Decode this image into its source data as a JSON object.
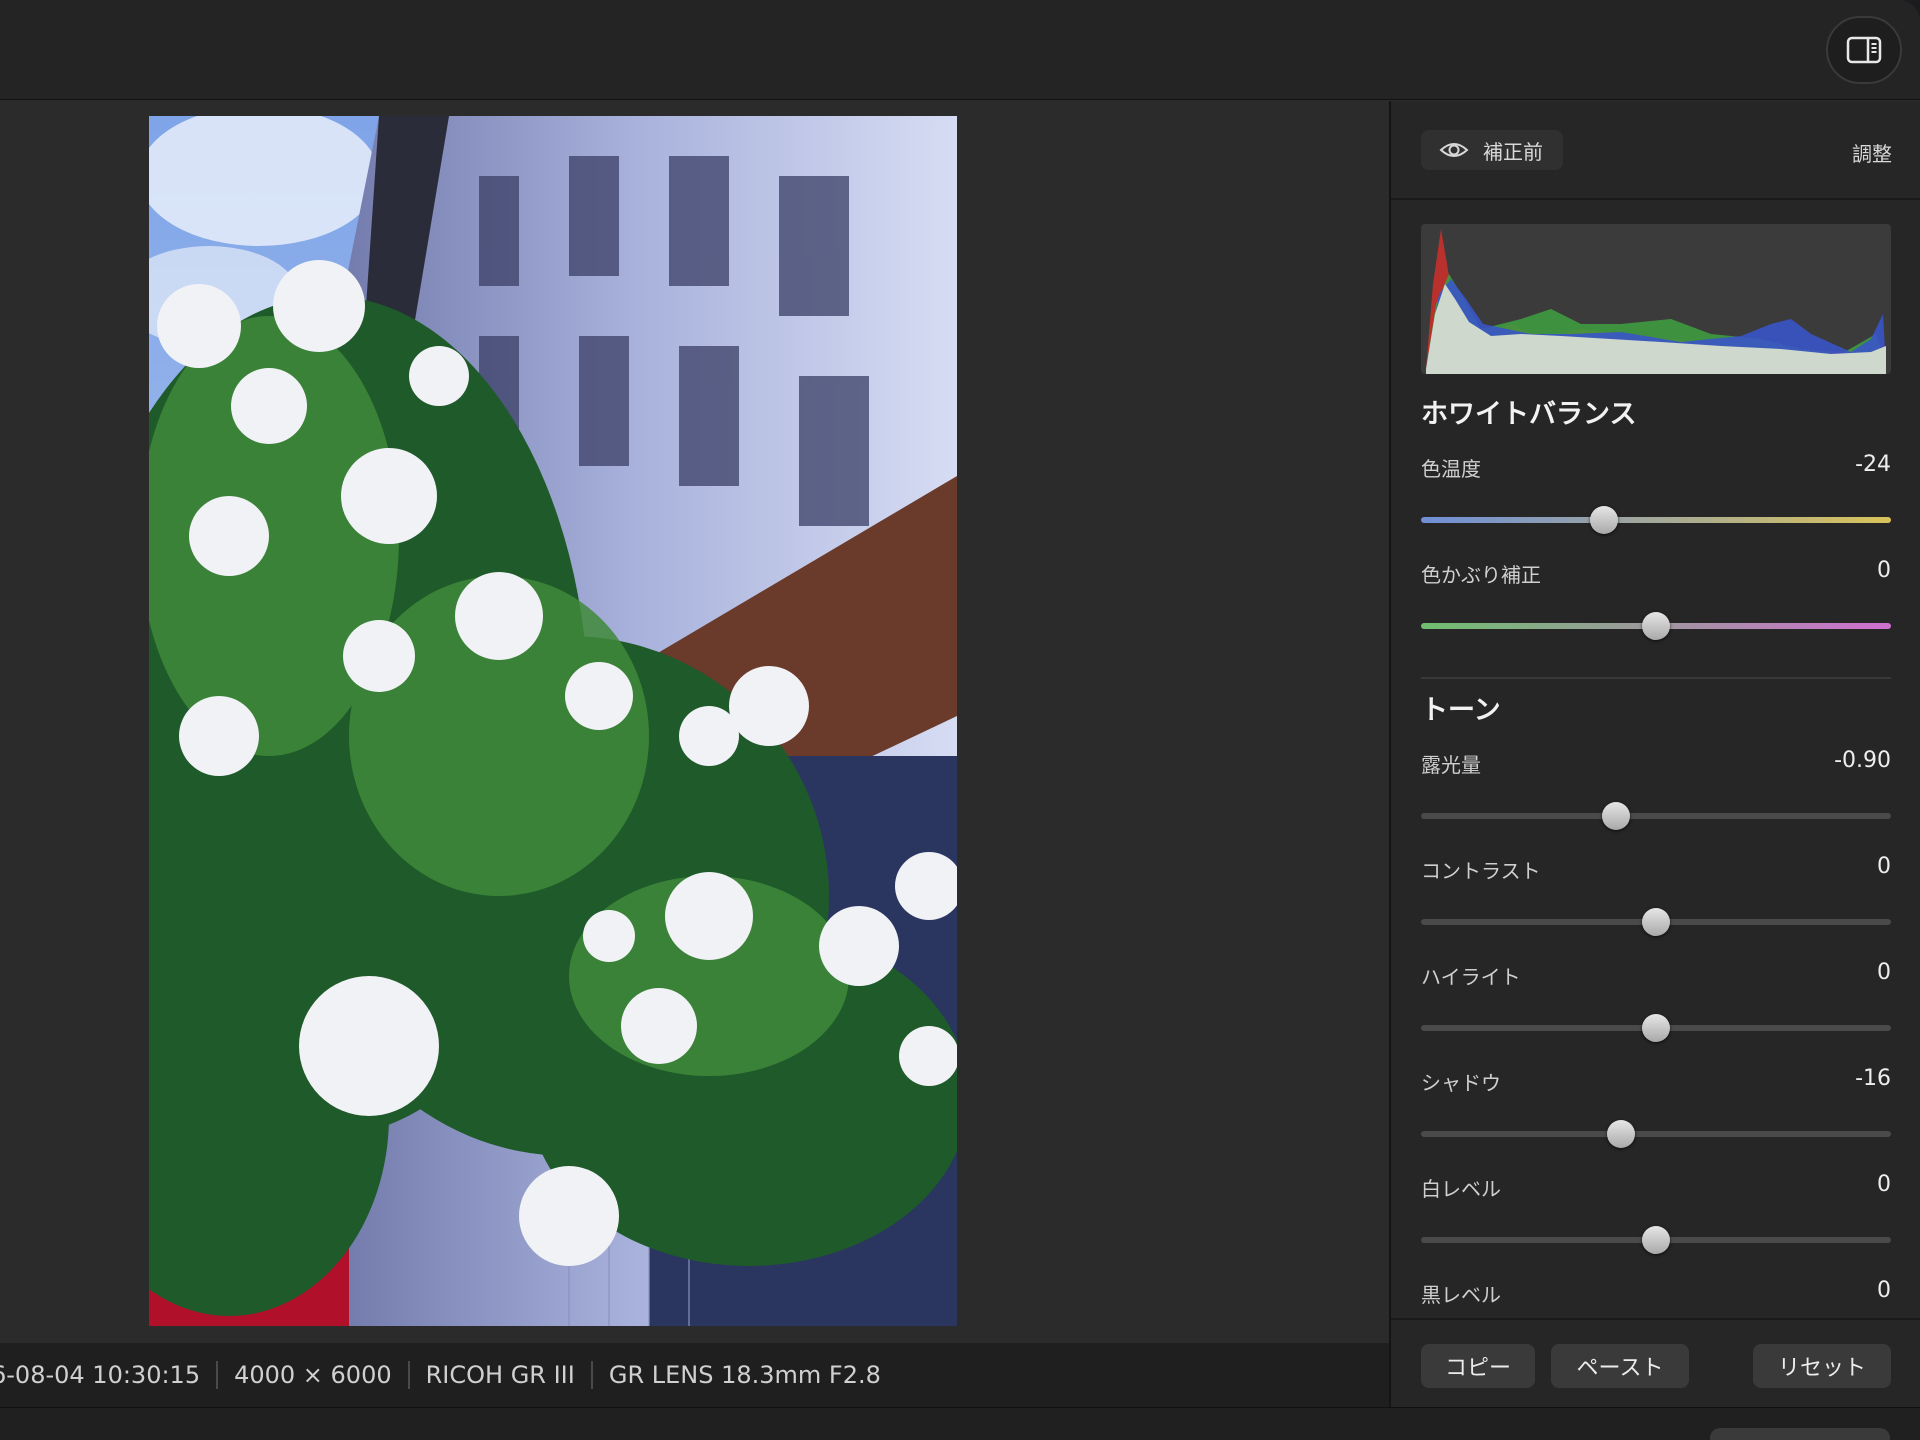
{
  "panel": {
    "before_label": "補正前",
    "adjust_label": "調整"
  },
  "white_balance": {
    "title": "ホワイトバランス",
    "temperature": {
      "label": "色温度",
      "value": "-24",
      "level": 0.39
    },
    "tint": {
      "label": "色かぶり補正",
      "value": "0",
      "level": 0.5
    }
  },
  "tone": {
    "title": "トーン",
    "exposure": {
      "label": "露光量",
      "value": "-0.90",
      "level": 0.415
    },
    "contrast": {
      "label": "コントラスト",
      "value": "0",
      "level": 0.5
    },
    "highlights": {
      "label": "ハイライト",
      "value": "0",
      "level": 0.5
    },
    "shadows": {
      "label": "シャドウ",
      "value": "-16",
      "level": 0.425
    },
    "whites": {
      "label": "白レベル",
      "value": "0",
      "level": 0.5
    },
    "blacks": {
      "label": "黒レベル",
      "value": "0"
    }
  },
  "footer": {
    "copy": "コピー",
    "paste": "ペースト",
    "reset": "リセット"
  },
  "status": {
    "datetime": "6-08-04 10:30:15",
    "dimensions": "4000 × 6000",
    "camera": "RICOH GR III",
    "lens": "GR LENS 18.3mm F2.8"
  },
  "colors": {
    "temperature_gradient": [
      "#6f8fd8",
      "#d9c35a"
    ],
    "tint_gradient": [
      "#6fbf6f",
      "#cf6fcf"
    ],
    "histogram_red": "#c8312b",
    "histogram_green": "#3f9b3f",
    "histogram_blue": "#3a55c8",
    "histogram_luma": "#cfd8cc"
  },
  "icons": {
    "sidebar_toggle": "sidebar-right-icon",
    "before": "eye-icon"
  }
}
